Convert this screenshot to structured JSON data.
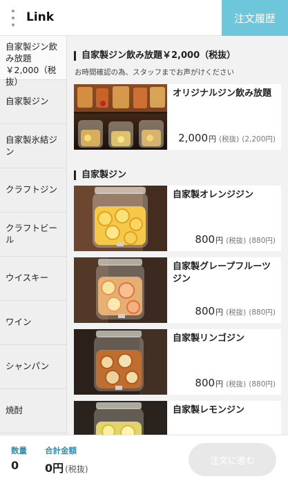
{
  "header": {
    "title": "Link",
    "history_label": "注文履歴"
  },
  "sidebar": {
    "items": [
      {
        "label": "自家製ジン飲み放題￥2,000（税抜）"
      },
      {
        "label": "自家製ジン"
      },
      {
        "label": "自家製氷結ジン"
      },
      {
        "label": "クラフトジン"
      },
      {
        "label": "クラフトビール"
      },
      {
        "label": "ウイスキー"
      },
      {
        "label": "ワイン"
      },
      {
        "label": "シャンパン"
      },
      {
        "label": "焼酎"
      }
    ]
  },
  "main": {
    "sections": [
      {
        "title": "自家製ジン飲み放題￥2,000（税抜）",
        "note": "お時間確認の為、スタッフまでお声がけください",
        "products": [
          {
            "name": "オリジナルジン飲み放題",
            "price": "2,000",
            "yen": "円",
            "tax": "(税抜)",
            "incl": "(2,200円)"
          }
        ]
      },
      {
        "title": "自家製ジン",
        "products": [
          {
            "name": "自家製オレンジジン",
            "price": "800",
            "yen": "円",
            "tax": "(税抜)",
            "incl": "(880円)"
          },
          {
            "name": "自家製グレープフルーツジン",
            "price": "800",
            "yen": "円",
            "tax": "(税抜)",
            "incl": "(880円)"
          },
          {
            "name": "自家製リンゴジン",
            "price": "800",
            "yen": "円",
            "tax": "(税抜)",
            "incl": "(880円)"
          },
          {
            "name": "自家製レモンジン"
          }
        ]
      }
    ]
  },
  "footer": {
    "quantity_label": "数量",
    "quantity_value": "0",
    "total_label": "合計金額",
    "total_value": "0円",
    "total_tax": "(税抜)",
    "checkout_label": "注文に進む"
  },
  "colors": {
    "accent": "#6ec6da",
    "label_blue": "#2a8fb5",
    "disabled_button": "#e8e8e8"
  },
  "icons": [
    "more-vert-icon"
  ]
}
